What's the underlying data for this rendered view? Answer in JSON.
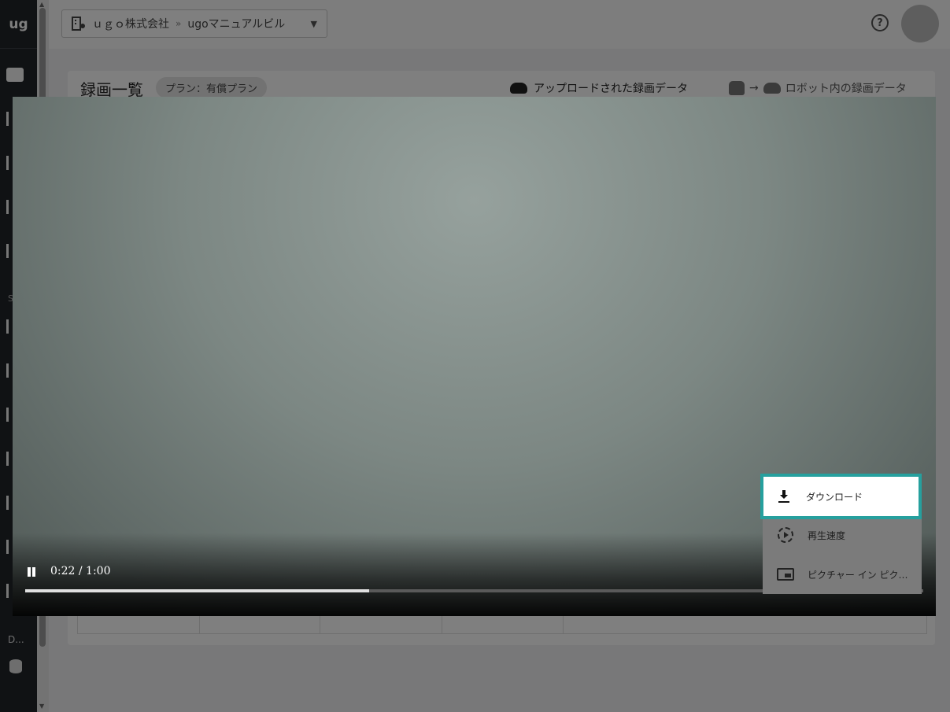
{
  "nav": {
    "logo": "ug",
    "section_label": "S",
    "user_label": "D..."
  },
  "topbar": {
    "company": "ｕｇｏ株式会社",
    "separator": "»",
    "building": "ugoマニュアルビル",
    "help_symbol": "?"
  },
  "card": {
    "title": "録画一覧",
    "plan_badge": "プラン：有償プラン",
    "legend_uploaded": "アップロードされた録画データ",
    "legend_robot": "ロボット内の録画データ",
    "legend_arrow": "→"
  },
  "video": {
    "time": "0:22 / 1:00",
    "progress": 0.383
  },
  "menu": {
    "items": [
      {
        "label": "ダウンロード",
        "icon": "download-icon"
      },
      {
        "label": "再生速度",
        "icon": "playback-speed-icon"
      },
      {
        "label": "ピクチャー イン ピクチャー",
        "icon": "picture-in-picture-icon"
      }
    ]
  },
  "colors": {
    "highlight": "#26a09e",
    "nav_bg": "#212529"
  }
}
